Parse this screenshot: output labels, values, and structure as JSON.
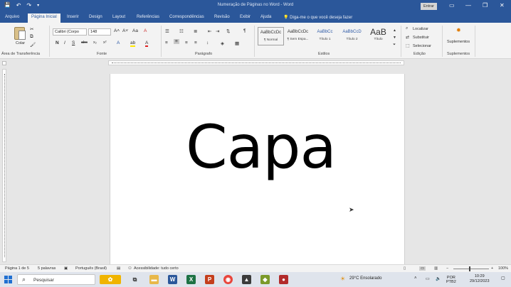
{
  "window": {
    "title": "Numeração de Páginas no Word - Word",
    "signin_label": "Entrar",
    "minimize_glyph": "—",
    "restore_glyph": "❐",
    "close_glyph": "✕",
    "save_glyph": "💾",
    "undo_glyph": "↶",
    "redo_glyph": "↷",
    "customize_glyph": "▾"
  },
  "tabs": [
    {
      "label": "Arquivo"
    },
    {
      "label": "Página Inicial",
      "active": true
    },
    {
      "label": "Inserir"
    },
    {
      "label": "Design"
    },
    {
      "label": "Layout"
    },
    {
      "label": "Referências"
    },
    {
      "label": "Correspondências"
    },
    {
      "label": "Revisão"
    },
    {
      "label": "Exibir"
    },
    {
      "label": "Ajuda"
    }
  ],
  "tell_me": {
    "glyph": "💡",
    "text": "Diga-me o que você deseja fazer"
  },
  "ribbon": {
    "clipboard": {
      "paste_label": "Colar",
      "group_label": "Área de Transferência"
    },
    "font": {
      "name": "Calibri (Corpo",
      "size": "148",
      "group_label": "Fonte",
      "bold": "N",
      "italic": "I",
      "underline": "S",
      "strike": "abc",
      "subscript": "x₂",
      "superscript": "x²",
      "grow": "A˄",
      "shrink": "A˅",
      "case": "Aa",
      "clear": "A",
      "highlight": "ab",
      "color": "A"
    },
    "paragraph": {
      "group_label": "Parágrafo",
      "pilcrow": "¶"
    },
    "styles": {
      "group_label": "Estilos",
      "items": [
        {
          "preview": "AaBbCcDc",
          "name": "¶ Normal"
        },
        {
          "preview": "AaBbCcDc",
          "name": "¶ Sem Espa..."
        },
        {
          "preview": "AaBbCc",
          "name": "Título 1"
        },
        {
          "preview": "AaBbCcD",
          "name": "Título 2"
        },
        {
          "preview": "AaB",
          "name": "Título"
        }
      ]
    },
    "editing": {
      "group_label": "Edição",
      "find": "Localizar",
      "replace": "Substituir",
      "select": "Selecionar"
    },
    "addins": {
      "label": "Suplementos",
      "group_label": "Suplementos"
    }
  },
  "document": {
    "text": "Capa"
  },
  "statusbar": {
    "page": "Página 1 de 5",
    "words": "5 palavras",
    "language": "Português (Brasil)",
    "accessibility": "Acessibilidade: tudo certo",
    "zoom": "100%"
  },
  "taskbar": {
    "search_placeholder": "Pesquisar",
    "weather": "29°C  Ensolarado",
    "language": "POR",
    "layout": "PTB2",
    "time": "10:29",
    "date": "29/12/2023"
  },
  "colors": {
    "word_blue": "#2b579a",
    "page": "#ffffff"
  }
}
